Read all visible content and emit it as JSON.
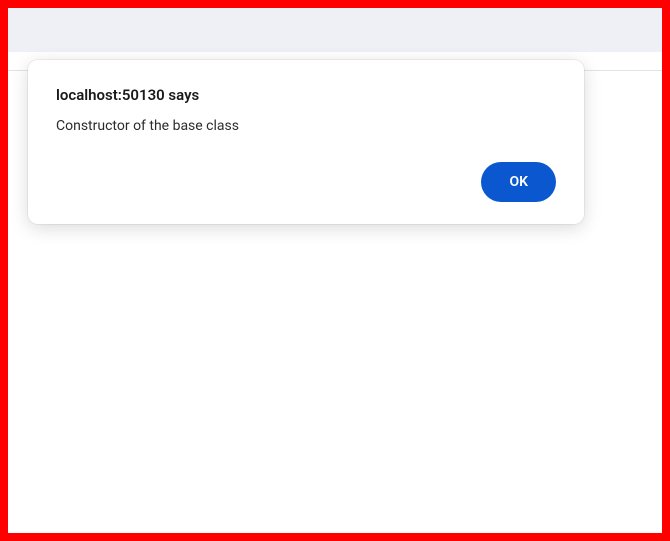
{
  "alert": {
    "title": "localhost:50130 says",
    "message": "Constructor of the base class",
    "ok_label": "OK"
  }
}
